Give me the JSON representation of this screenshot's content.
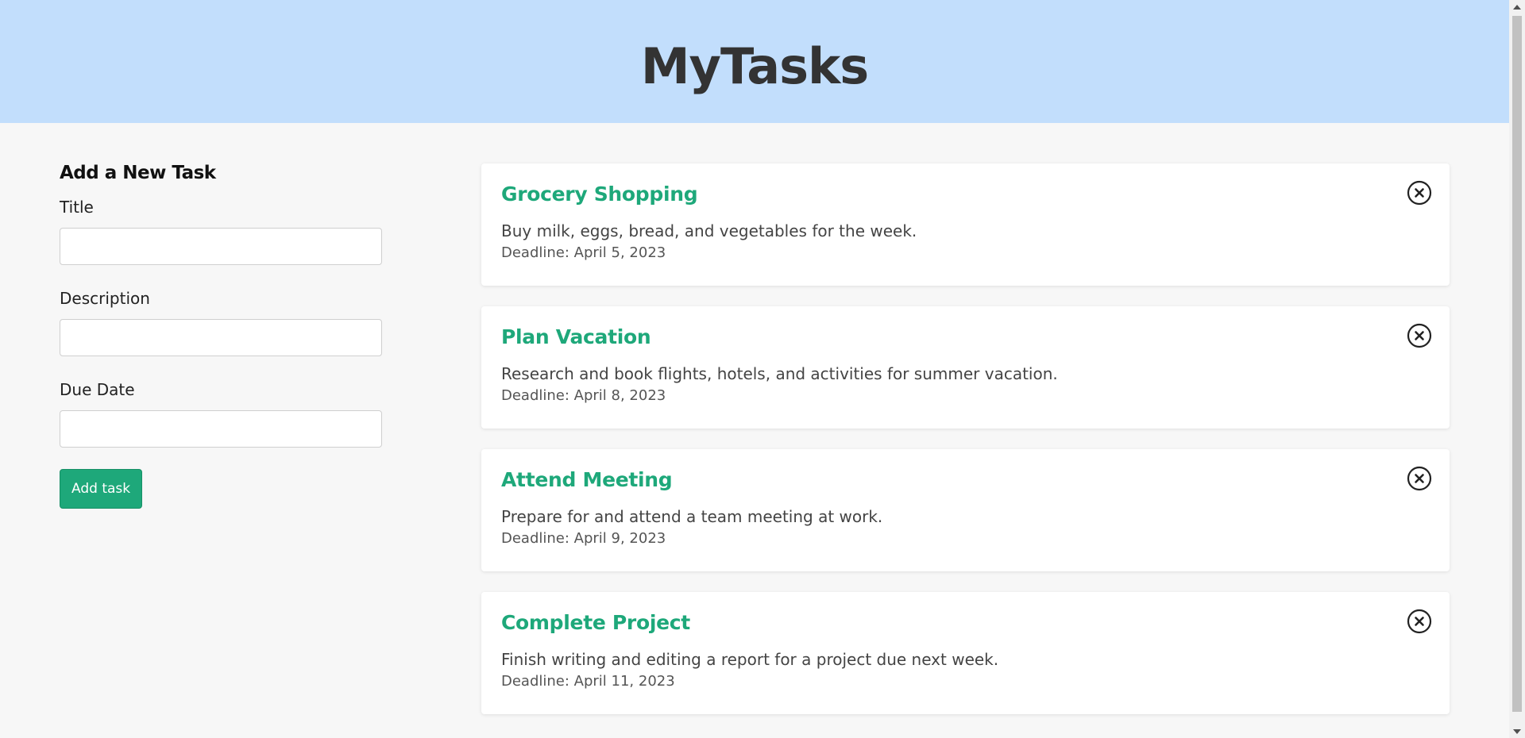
{
  "app": {
    "title": "MyTasks"
  },
  "form": {
    "heading": "Add a New Task",
    "title_label": "Title",
    "title_value": "",
    "description_label": "Description",
    "description_value": "",
    "due_date_label": "Due Date",
    "due_date_value": "",
    "submit_label": "Add task"
  },
  "tasks": [
    {
      "title": "Grocery Shopping",
      "description": "Buy milk, eggs, bread, and vegetables for the week.",
      "deadline": "Deadline: April 5, 2023"
    },
    {
      "title": "Plan Vacation",
      "description": "Research and book flights, hotels, and activities for summer vacation.",
      "deadline": "Deadline: April 8, 2023"
    },
    {
      "title": "Attend Meeting",
      "description": "Prepare for and attend a team meeting at work.",
      "deadline": "Deadline: April 9, 2023"
    },
    {
      "title": "Complete Project",
      "description": "Finish writing and editing a report for a project due next week.",
      "deadline": "Deadline: April 11, 2023"
    }
  ],
  "icons": {
    "delete": "close-circle-icon",
    "scroll_up": "scroll-up-arrow-icon",
    "scroll_down": "scroll-down-arrow-icon"
  },
  "colors": {
    "header_bg": "#c2defc",
    "accent": "#1ea87a",
    "page_bg": "#f7f7f7"
  }
}
